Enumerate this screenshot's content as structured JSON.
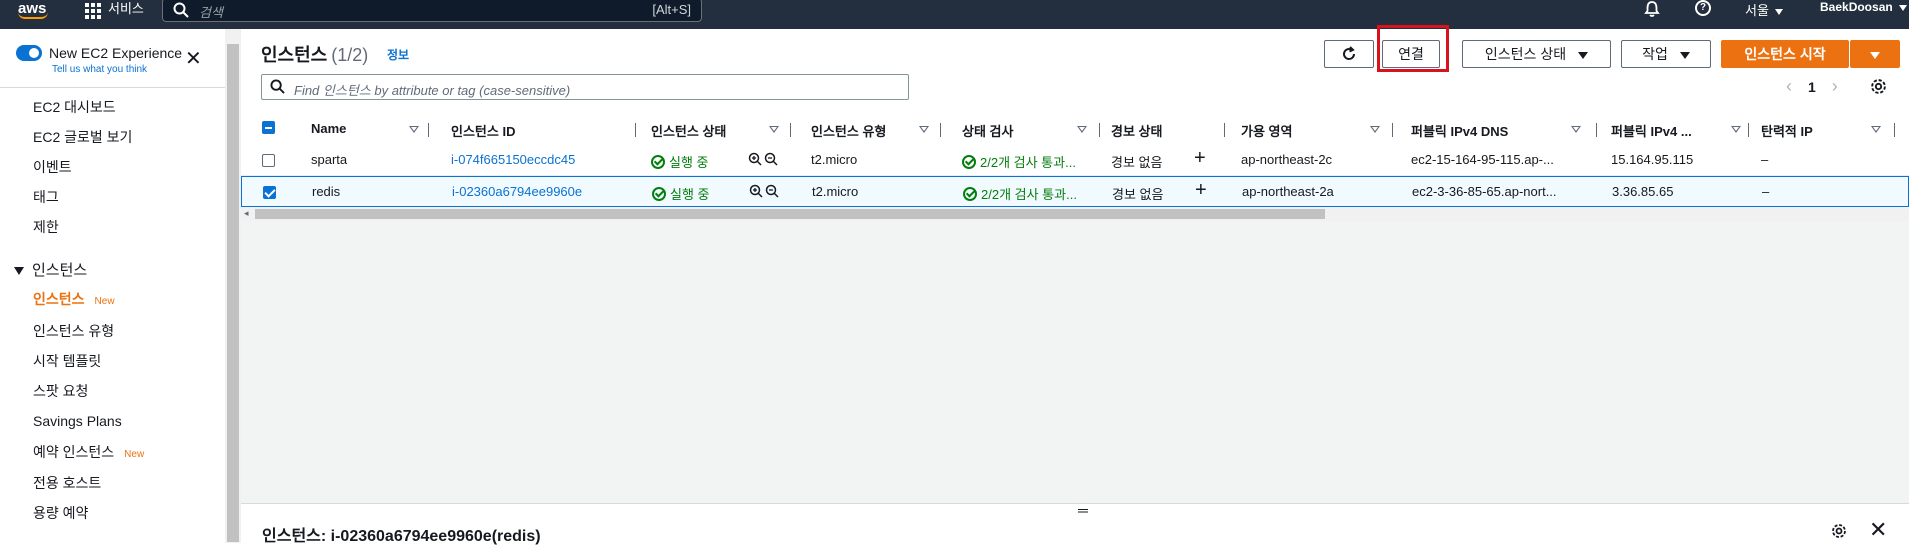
{
  "topnav": {
    "logo": "aws",
    "services_label": "서비스",
    "search_placeholder": "검색",
    "search_shortcut": "[Alt+S]",
    "region": "서울",
    "user": "BaekDoosan"
  },
  "sidebar": {
    "new_experience": "New EC2 Experience",
    "tell_us": "Tell us what you think",
    "items_top": [
      "EC2 대시보드",
      "EC2 글로벌 보기",
      "이벤트",
      "태그",
      "제한"
    ],
    "section": "인스턴스",
    "items_instances": [
      {
        "label": "인스턴스",
        "badge": "New"
      },
      {
        "label": "인스턴스 유형",
        "badge": ""
      },
      {
        "label": "시작 템플릿",
        "badge": ""
      },
      {
        "label": "스팟 요청",
        "badge": ""
      },
      {
        "label": "Savings Plans",
        "badge": ""
      },
      {
        "label": "예약 인스턴스",
        "badge": "New"
      },
      {
        "label": "전용 호스트",
        "badge": ""
      },
      {
        "label": "용량 예약",
        "badge": ""
      }
    ]
  },
  "header": {
    "title": "인스턴스",
    "count": "(1/2)",
    "info": "정보",
    "connect_label": "연결",
    "state_label": "인스턴스 상태",
    "actions_label": "작업",
    "launch_label": "인스턴스 시작",
    "filter_placeholder": "Find 인스턴스 by attribute or tag (case-sensitive)",
    "page": "1"
  },
  "table": {
    "columns": [
      "Name",
      "인스턴스 ID",
      "인스턴스 상태",
      "인스턴스 유형",
      "상태 검사",
      "경보 상태",
      "가용 영역",
      "퍼블릭 IPv4 DNS",
      "퍼블릭 IPv4 ...",
      "탄력적 IP"
    ],
    "rows": [
      {
        "name": "sparta",
        "id": "i-074f665150eccdc45",
        "state": "실행 중",
        "type": "t2.micro",
        "check": "2/2개 검사 통과...",
        "alarm": "경보 없음",
        "az": "ap-northeast-2c",
        "dns": "ec2-15-164-95-115.ap-...",
        "ip": "15.164.95.115",
        "eip": "–",
        "selected": false
      },
      {
        "name": "redis",
        "id": "i-02360a6794ee9960e",
        "state": "실행 중",
        "type": "t2.micro",
        "check": "2/2개 검사 통과...",
        "alarm": "경보 없음",
        "az": "ap-northeast-2a",
        "dns": "ec2-3-36-85-65.ap-nort...",
        "ip": "3.36.85.65",
        "eip": "–",
        "selected": true
      }
    ]
  },
  "detail": {
    "title": "인스턴스: i-02360a6794ee9960e(redis)"
  },
  "colors": {
    "nav_bg": "#232f3e",
    "accent_orange": "#ec7211",
    "link_blue": "#0972d3",
    "ok_green": "#037f0c",
    "highlight_red": "#d7141c"
  }
}
